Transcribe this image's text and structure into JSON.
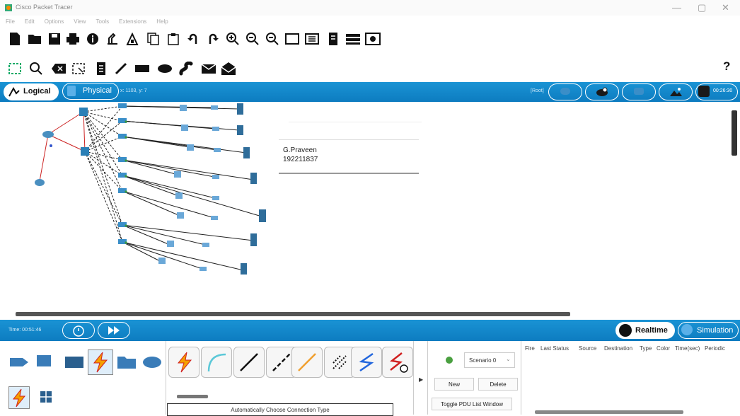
{
  "window": {
    "title": "Cisco Packet Tracer",
    "controls": [
      "—",
      "▢",
      "✕"
    ]
  },
  "menu": [
    "File",
    "Edit",
    "Options",
    "View",
    "Tools",
    "Extensions",
    "Help"
  ],
  "toolbar": {
    "help_label": "?"
  },
  "workspace": {
    "logical_label": "Logical",
    "physical_label": "Physical",
    "coords": "x: 1103, y: 7",
    "root_label": "[Root]",
    "clock": "00:26:30"
  },
  "note": {
    "line1": "G.Praveen",
    "line2": "192211837"
  },
  "timebar": {
    "time": "Time: 00:51:46",
    "realtime_label": "Realtime",
    "simulation_label": "Simulation"
  },
  "connection": {
    "hint": "Automatically Choose Connection Type"
  },
  "scenario": {
    "selected": "Scenario 0",
    "new_label": "New",
    "delete_label": "Delete",
    "toggle_label": "Toggle PDU List Window"
  },
  "pdu_columns": [
    "Fire",
    "Last Status",
    "Source",
    "Destination",
    "Type",
    "Color",
    "Time(sec)",
    "Periodic"
  ],
  "colors": {
    "accent_blue": "#1a93d4",
    "link_green": "#3a9a3a",
    "link_red": "#cc2222"
  }
}
